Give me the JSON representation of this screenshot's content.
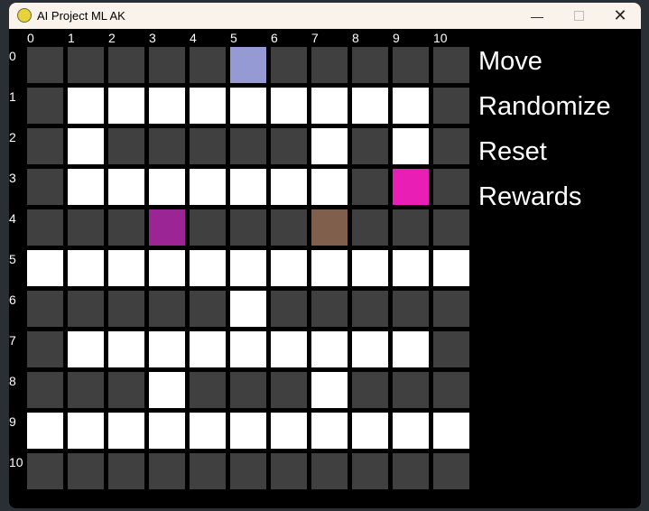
{
  "window": {
    "title": "AI Project ML AK",
    "minimize_icon": "minimize-icon",
    "maximize_icon": "maximize-icon",
    "close_icon": "close-icon"
  },
  "grid": {
    "column_labels": [
      "0",
      "1",
      "2",
      "3",
      "4",
      "5",
      "6",
      "7",
      "8",
      "9",
      "10"
    ],
    "row_labels": [
      "0",
      "1",
      "2",
      "3",
      "4",
      "5",
      "6",
      "7",
      "8",
      "9",
      "10"
    ],
    "colors": {
      "D": "#404040",
      "W": "#ffffff",
      "B": "#9599d4",
      "P": "#e91eb4",
      "U": "#9c2596",
      "R": "#80604d"
    },
    "rows": [
      "DDDDDBDDDDD",
      "DWWWWWWWWWD",
      "DWDDDDDWDWD",
      "DWWWWWWWDPD",
      "DDDUDDDRDDD",
      "WWWWWWWWWWW",
      "DDDDDWDDDDD",
      "DWWWWWWWWWD",
      "DDDWDDDWDDD",
      "WWWWWWWWWWW",
      "DDDDDDDDDDD"
    ]
  },
  "menu": {
    "move": "Move",
    "randomize": "Randomize",
    "reset": "Reset",
    "rewards": "Rewards"
  }
}
